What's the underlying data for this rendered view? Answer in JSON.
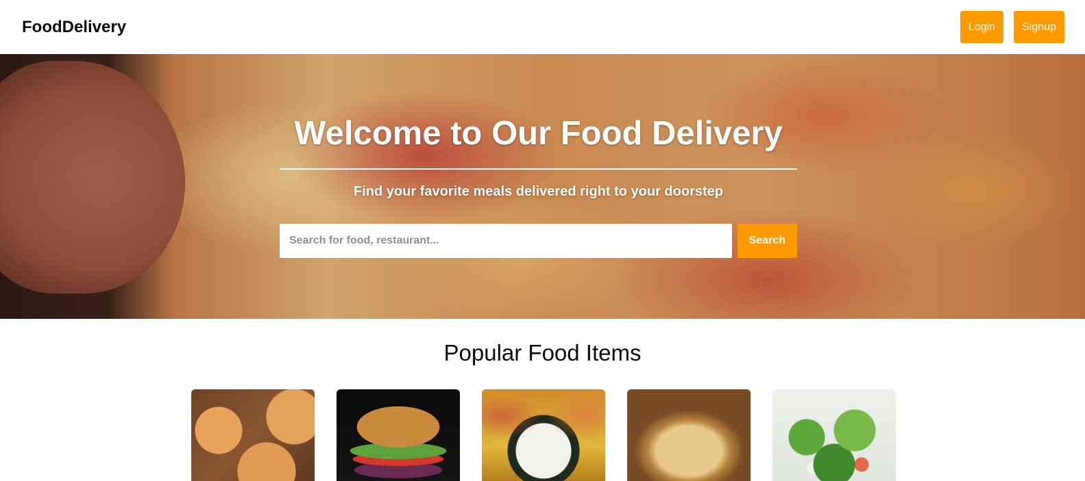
{
  "header": {
    "brand": "FoodDelivery",
    "login_label": "Login",
    "signup_label": "Signup"
  },
  "hero": {
    "title": "Welcome to Our Food Delivery",
    "subtitle": "Find your favorite meals delivered right to your doorstep",
    "search": {
      "value": "",
      "placeholder": "Search for food, restaurant...",
      "button_label": "Search"
    }
  },
  "popular": {
    "title": "Popular Food Items",
    "items": [
      {
        "image": "pizza-image"
      },
      {
        "image": "burger-image"
      },
      {
        "image": "sushi-image"
      },
      {
        "image": "pasta-image"
      },
      {
        "image": "salad-image"
      }
    ]
  },
  "colors": {
    "accent": "#ff9900",
    "text": "#0b0b0b",
    "background": "#ffffff"
  }
}
